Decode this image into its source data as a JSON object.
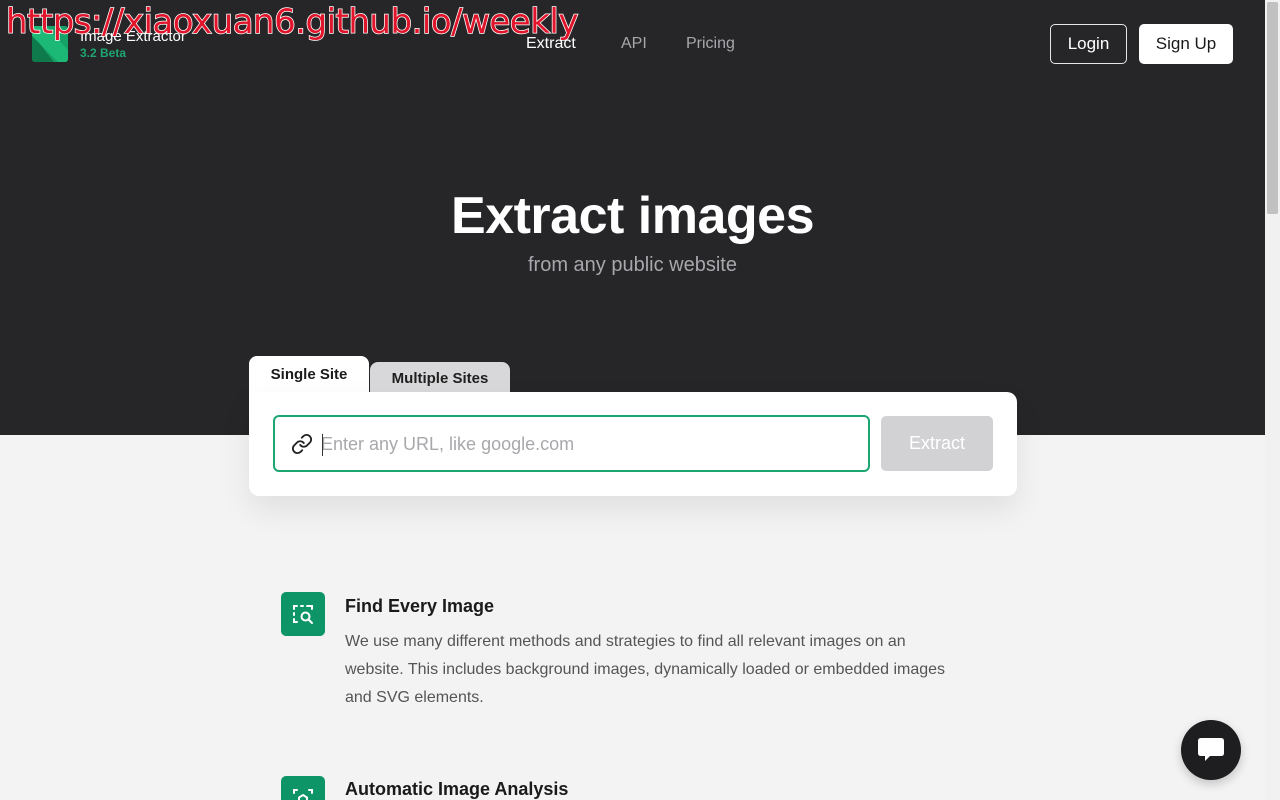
{
  "watermark": "https://xiaoxuan6.github.io/weekly",
  "brand": {
    "name": "Image Extractor",
    "version": "3.2 Beta",
    "logo_icon": "image-logo-icon"
  },
  "nav": {
    "items": [
      {
        "label": "Extract",
        "active": true
      },
      {
        "label": "API",
        "active": false
      },
      {
        "label": "Pricing",
        "active": false
      }
    ],
    "login_label": "Login",
    "signup_label": "Sign Up"
  },
  "hero": {
    "title": "Extract images",
    "subtitle": "from any public website"
  },
  "extractor": {
    "tabs": [
      {
        "label": "Single Site",
        "active": true
      },
      {
        "label": "Multiple Sites",
        "active": false
      }
    ],
    "url_placeholder": "Enter any URL, like google.com",
    "url_value": "",
    "link_icon": "link-icon",
    "extract_label": "Extract"
  },
  "features": [
    {
      "icon": "image-search-icon",
      "title": "Find Every Image",
      "text": "We use many different methods and strategies to find all relevant images on an website. This includes background images, dynamically loaded or embedded images and SVG elements."
    },
    {
      "icon": "image-analysis-icon",
      "title": "Automatic Image Analysis"
    }
  ],
  "chat": {
    "icon": "chat-icon"
  },
  "colors": {
    "hero_bg": "#262628",
    "accent": "#1ea672",
    "feature_icon_bg": "#0d9467",
    "page_bg": "#f3f3f3"
  }
}
